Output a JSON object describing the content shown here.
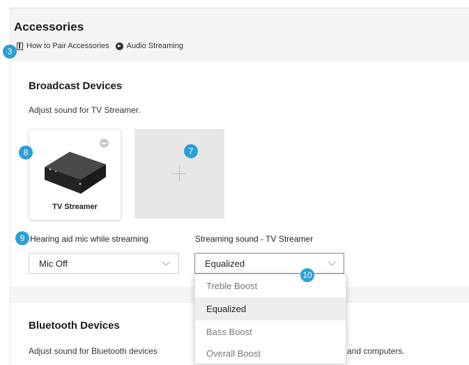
{
  "header": {
    "title": "Accessories",
    "links": [
      {
        "icon": "book-icon",
        "label": "How to Pair Accessories"
      },
      {
        "icon": "arrow-circle-icon",
        "label": "Audio Streaming"
      }
    ]
  },
  "badges": {
    "b3": "3",
    "b7": "7",
    "b8": "8",
    "b9": "9",
    "b10": "10"
  },
  "broadcast": {
    "title": "Broadcast Devices",
    "description": "Adjust sound for TV Streamer.",
    "device": {
      "name": "TV Streamer"
    }
  },
  "fields": {
    "mic_label": "Hearing aid mic while streaming",
    "mic_value": "Mic Off",
    "sound_label": "Streaming sound - TV Streamer",
    "sound_value": "Equalized"
  },
  "dropdown": {
    "options": [
      "Treble Boost",
      "Equalized",
      "Bass Boost",
      "Overall Boost"
    ],
    "selected": "Equalized"
  },
  "bluetooth": {
    "title": "Bluetooth Devices",
    "description_left": "Adjust sound for Bluetooth devices",
    "description_right": "and computers."
  },
  "colors": {
    "badge": "#2a9fd8",
    "header_bg": "#f4f4f4",
    "add_card_bg": "#e7e7e7"
  }
}
